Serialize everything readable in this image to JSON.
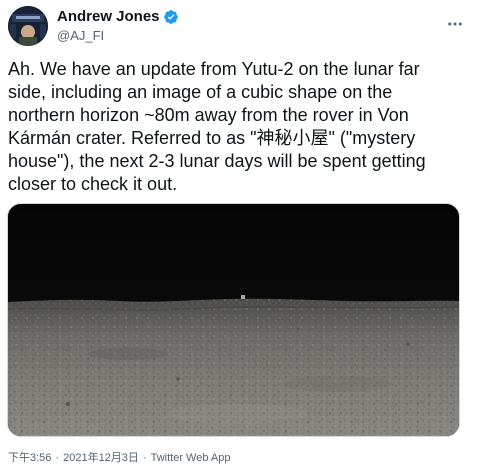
{
  "author": {
    "display_name": "Andrew Jones",
    "handle": "@AJ_FI",
    "verified": true,
    "avatar_icon": "avatar-image"
  },
  "header": {
    "more_icon": "more-horizontal-icon"
  },
  "tweet": {
    "lines": [
      "Ah. We have an update from Yutu-2 on the lunar far",
      "side, including an image of a cubic shape on the",
      "northern horizon ~80m away from the rover in Von",
      "Kármán crater. Referred to as \"神秘小屋\" (\"mystery",
      "house\"), the next 2-3 lunar days will be spent getting",
      "closer to check it out."
    ]
  },
  "media": {
    "description_icon": "lunar-surface-photo"
  },
  "meta": {
    "time": "下午3:56",
    "date": "2021年12月3日",
    "separator": "·",
    "source": "Twitter Web App"
  },
  "colors": {
    "text_primary": "#0f1419",
    "text_secondary": "#536471",
    "verified_blue": "#1d9bf0",
    "border": "#cfd9de"
  }
}
